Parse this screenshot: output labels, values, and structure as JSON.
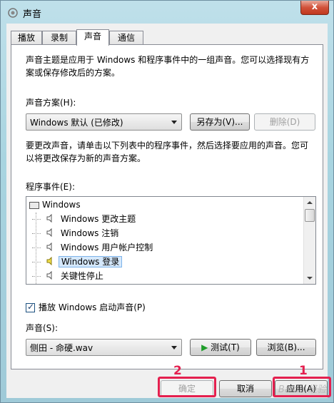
{
  "window": {
    "title": "声音",
    "close_label": "x"
  },
  "tabs": [
    {
      "label": "播放",
      "active": false
    },
    {
      "label": "录制",
      "active": false
    },
    {
      "label": "声音",
      "active": true
    },
    {
      "label": "通信",
      "active": false
    }
  ],
  "intro": {
    "line1": "声音主题是应用于 Windows 和程序事件中的一组声音。您可以选择现有方",
    "line2": "案或保存修改后的方案。"
  },
  "scheme": {
    "label": "声音方案(H):",
    "selected": "Windows 默认 (已修改)",
    "save_as": "另存为(V)...",
    "delete": "删除(D)"
  },
  "instructions": {
    "line1": "要更改声音，请单击以下列表中的程序事件，然后选择要应用的声音。您可",
    "line2": "以将更改保存为新的声音方案。"
  },
  "events": {
    "label": "程序事件(E):",
    "root": "Windows",
    "items": [
      {
        "label": "Windows 更改主题",
        "has_sound": false,
        "selected": false
      },
      {
        "label": "Windows 注销",
        "has_sound": false,
        "selected": false
      },
      {
        "label": "Windows 用户帐户控制",
        "has_sound": false,
        "selected": false
      },
      {
        "label": "Windows 登录",
        "has_sound": true,
        "selected": true
      },
      {
        "label": "关键性停止",
        "has_sound": false,
        "selected": false
      }
    ]
  },
  "startup": {
    "label": "播放 Windows 启动声音(P)",
    "checked": true
  },
  "sound": {
    "label": "声音(S):",
    "selected": "侧田 - 命硬.wav",
    "test": "测试(T)",
    "browse": "浏览(B)..."
  },
  "footer": {
    "ok": "确定",
    "cancel": "取消",
    "apply": "应用(A)"
  },
  "annotations": {
    "mark1": "1",
    "mark2": "2",
    "highlight_color": "#e4204f"
  },
  "watermark": "Baidu 经验"
}
